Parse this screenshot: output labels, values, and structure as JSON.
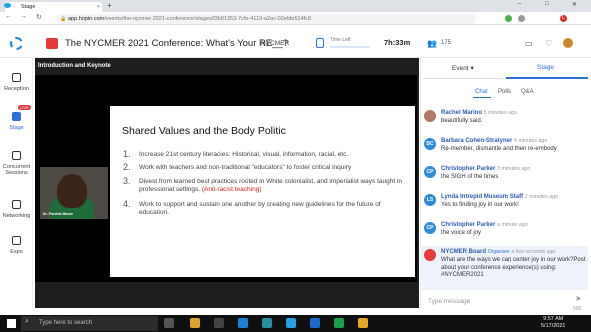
{
  "browser": {
    "tab_title": "Stage",
    "close": "×",
    "new_tab": "+",
    "url_host": "app.hopin.com",
    "url_path": "/events/the-nycmer-2021-conference/stages/f3b91353-7cfe-4119-a2ac-02efde514fc0",
    "win_min": "–",
    "win_max": "□",
    "win_close": "✕",
    "nav_back": "←",
    "nav_fwd": "→",
    "nav_reload": "↻",
    "user_initial": "L"
  },
  "header": {
    "event_title": "The NYCMER 2021 Conference: What's Your RE__?",
    "stage_name": "NYCMER",
    "time_left_label": "Time Left",
    "time_left_value": "7h:33m",
    "people_count": "175"
  },
  "sidebar": {
    "items": [
      {
        "label": "Reception"
      },
      {
        "label": "Stage",
        "badge": "LIVE"
      },
      {
        "label": "Concurrent Sessions"
      },
      {
        "label": "Networking"
      },
      {
        "label": "Expo"
      }
    ]
  },
  "stage": {
    "title": "Introduction and Keynote",
    "speaker_name": "Dr. Porchia Moore"
  },
  "slide": {
    "title": "Shared Values and the Body Politic",
    "points": [
      {
        "num": "1.",
        "text": "Increase 21st century literacies: Historical, visual, information, racial, etc."
      },
      {
        "num": "2.",
        "text": "Work with teachers and non-traditional \"educators\" to foster critical inquiry"
      },
      {
        "num": "3.",
        "text": "Divest from learned best practices rooted in White colonialist, and imperialist ways taught in professional settings.",
        "red": "(Anti-racist teaching)"
      },
      {
        "num": "4.",
        "text": "Work to support and sustain one another by creating new guidelines for the future of education."
      }
    ]
  },
  "panel": {
    "tab_event": "Event",
    "tab_stage": "Stage",
    "subtabs": [
      "Chat",
      "Polls",
      "Q&A"
    ],
    "messages": [
      {
        "initials": "",
        "name": "Rachel Marino",
        "time": "5 minutes ago",
        "text": "beautifully said.",
        "color": "#b07a68"
      },
      {
        "initials": "BC",
        "name": "Barbara Cohen-Stratyner",
        "time": "4 minutes ago",
        "text": "Re-member, dismantle and then re-embody",
        "color": "#2f8ad8"
      },
      {
        "initials": "CP",
        "name": "Christopher Parker",
        "time": "3 minutes ago",
        "text": "the SIGH of the times",
        "color": "#2f8ad8"
      },
      {
        "initials": "LS",
        "name": "Lynda Intrepid Museum Staff",
        "time": "2 minutes ago",
        "text": "Yes to finding joy in our work!",
        "color": "#2f8ad8"
      },
      {
        "initials": "CP",
        "name": "Christopher Parker",
        "time": "a minute ago",
        "text": "the voice of joy",
        "color": "#2f8ad8"
      },
      {
        "initials": "",
        "name": "NYCMER Board",
        "role": "Organiser",
        "time": "a few seconds ago",
        "text": "What are the ways we can center joy in our work?Post about your conference experience(s) using: #NYCMER2021",
        "color": "#e23b3b"
      }
    ],
    "input_placeholder": "Type message",
    "char_count": "500",
    "send": "➤"
  },
  "taskbar": {
    "search_placeholder": "Type here to search",
    "time": "9:57 AM",
    "date": "5/17/2021"
  }
}
